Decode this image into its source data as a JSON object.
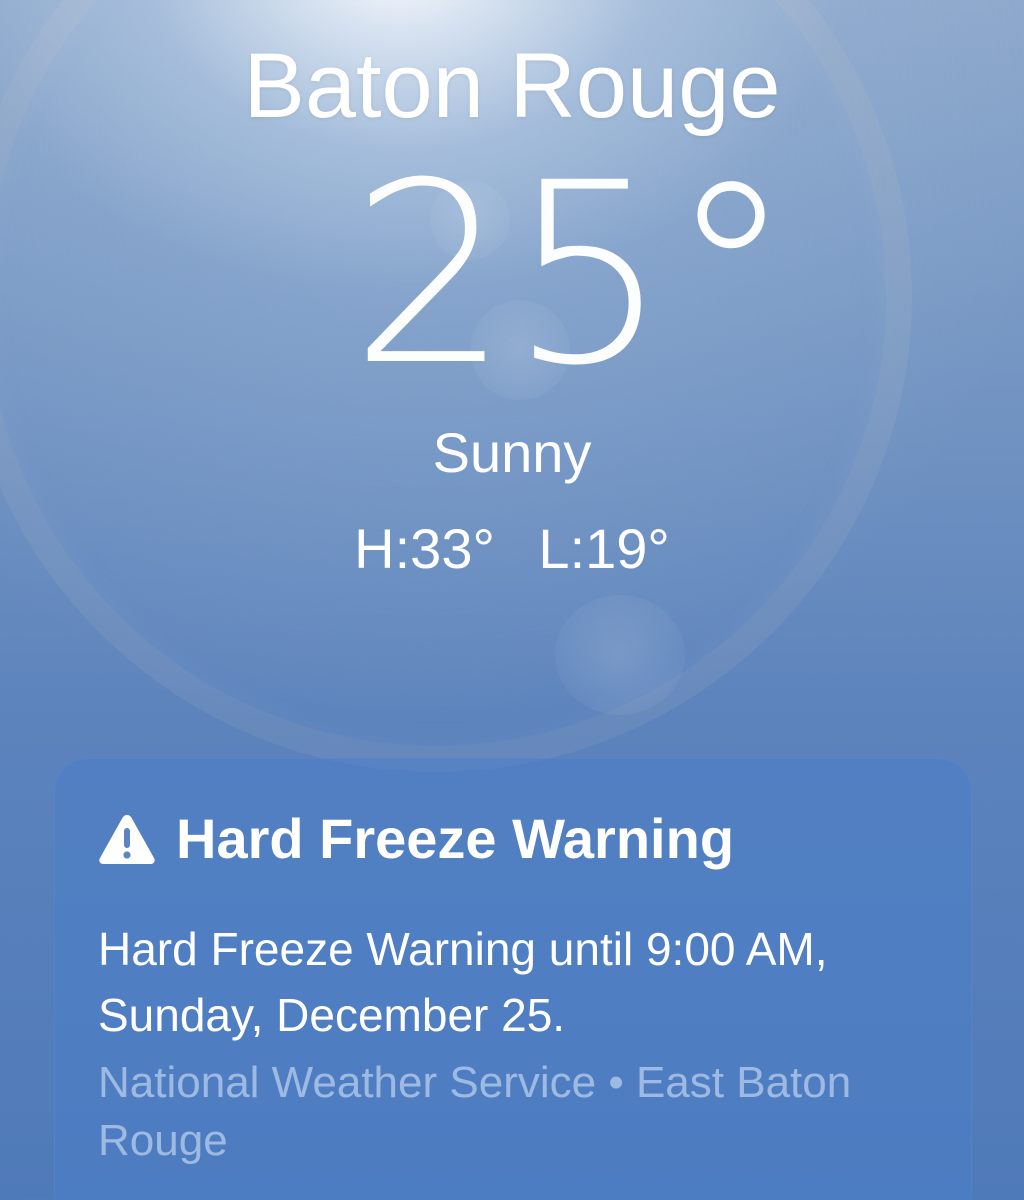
{
  "weather": {
    "city": "Baton Rouge",
    "temperature": "25°",
    "condition": "Sunny",
    "high": "H:33°",
    "low": "L:19°"
  },
  "alert": {
    "icon": "warning-triangle-icon",
    "title": "Hard Freeze Warning",
    "body": "Hard Freeze Warning until 9:00 AM, Sunday, December 25.",
    "source": "National Weather Service • East Baton Rouge"
  },
  "colors": {
    "sky_top": "#8ea9cc",
    "sky_bottom": "#4f7ab9",
    "card": "#4b7dc8"
  }
}
